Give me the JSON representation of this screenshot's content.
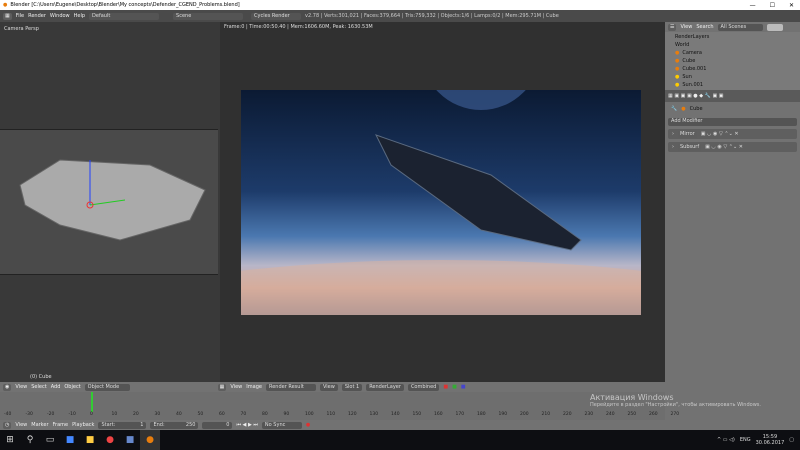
{
  "window": {
    "title": "Blender [C:\\Users\\Eugene\\Desktop\\Blender\\My concepts\\Defender_CGEND_Problems.blend]",
    "min": "—",
    "max": "☐",
    "close": "✕"
  },
  "menubar": {
    "menus": [
      "File",
      "Render",
      "Window",
      "Help"
    ],
    "layout": "Default",
    "scene": "Scene",
    "engine": "Cycles Render",
    "stats": "v2.78 | Verts:301,021 | Faces:379,664 | Tris:759,332 | Objects:1/6 | Lamps:0/2 | Mem:295.71M | Cube"
  },
  "viewport": {
    "label": "Camera Persp",
    "object": "(0) Cube"
  },
  "image_editor": {
    "info": "Frame:0 | Time:00:50.40 | Mem:1606.60M, Peak: 1630.53M"
  },
  "outliner": {
    "view": "View",
    "search": "Search",
    "scenes": "All Scenes",
    "items": [
      "RenderLayers",
      "World",
      "Camera",
      "Cube",
      "Cube.001",
      "Sun",
      "Sun.001"
    ]
  },
  "properties": {
    "object": "Cube",
    "add_modifier": "Add Modifier",
    "modifiers": [
      "Mirror",
      "Subsurf"
    ]
  },
  "view3d_header": {
    "menus": [
      "View",
      "Select",
      "Add",
      "Object"
    ],
    "mode": "Object Mode"
  },
  "image_header": {
    "menus": [
      "View",
      "Image"
    ],
    "image": "Render Result",
    "view": "View",
    "slot": "Slot 1",
    "layer": "RenderLayer",
    "pass": "Combined"
  },
  "timeline": {
    "ticks": [
      "-40",
      "-30",
      "-20",
      "-10",
      "0",
      "10",
      "20",
      "30",
      "40",
      "50",
      "60",
      "70",
      "80",
      "90",
      "100",
      "110",
      "120",
      "130",
      "140",
      "150",
      "160",
      "170",
      "180",
      "190",
      "200",
      "210",
      "220",
      "230",
      "240",
      "250",
      "260",
      "270"
    ],
    "current_frame": 0
  },
  "timeline_header": {
    "menus": [
      "View",
      "Marker",
      "Frame",
      "Playback"
    ],
    "start": "Start:",
    "start_val": "1",
    "end": "End:",
    "end_val": "250",
    "frame": "0",
    "sync": "No Sync"
  },
  "watermark": {
    "title": "Активация Windows",
    "text": "Перейдите в раздел \"Настройки\", чтобы активировать Windows."
  },
  "taskbar": {
    "lang": "ENG",
    "time": "15:59",
    "date": "30.06.2017"
  }
}
